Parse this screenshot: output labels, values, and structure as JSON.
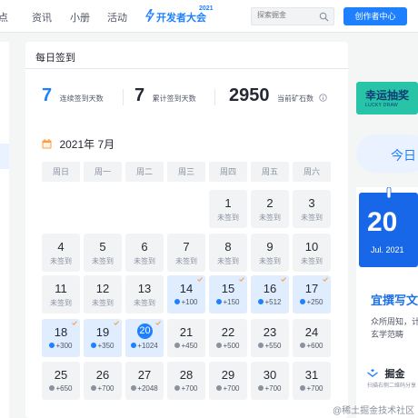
{
  "nav": {
    "items": [
      "点",
      "资讯",
      "小册",
      "活动"
    ],
    "dev_logo_text": "开发者大会",
    "dev_logo_year": "2021",
    "search_placeholder": "探索掘金",
    "creator_button": "创作者中心"
  },
  "card": {
    "title": "每日签到",
    "stats": [
      {
        "value": "7",
        "label": "连续签到天数"
      },
      {
        "value": "7",
        "label": "累计签到天数"
      },
      {
        "value": "2950",
        "label": "当前矿石数"
      }
    ],
    "month": "2021年 7月",
    "weekdays": [
      "周日",
      "周一",
      "周二",
      "周三",
      "周四",
      "周五",
      "周六"
    ],
    "days": [
      {
        "num": "1",
        "sub": "未签到"
      },
      {
        "num": "2",
        "sub": "未签到"
      },
      {
        "num": "3",
        "sub": "未签到"
      },
      {
        "num": "4",
        "sub": "未签到"
      },
      {
        "num": "5",
        "sub": "未签到"
      },
      {
        "num": "6",
        "sub": "未签到"
      },
      {
        "num": "7",
        "sub": "未签到"
      },
      {
        "num": "8",
        "sub": "未签到"
      },
      {
        "num": "9",
        "sub": "未签到"
      },
      {
        "num": "10",
        "sub": "未签到"
      },
      {
        "num": "11",
        "sub": "未签到"
      },
      {
        "num": "12",
        "sub": "未签到"
      },
      {
        "num": "13",
        "sub": "未签到"
      },
      {
        "num": "14",
        "sub": "+100"
      },
      {
        "num": "15",
        "sub": "+150"
      },
      {
        "num": "16",
        "sub": "+512"
      },
      {
        "num": "17",
        "sub": "+250"
      },
      {
        "num": "18",
        "sub": "+300"
      },
      {
        "num": "19",
        "sub": "+350"
      },
      {
        "num": "20",
        "sub": "+1024"
      },
      {
        "num": "21",
        "sub": "+450"
      },
      {
        "num": "22",
        "sub": "+500"
      },
      {
        "num": "23",
        "sub": "+550"
      },
      {
        "num": "24",
        "sub": "+600"
      },
      {
        "num": "25",
        "sub": "+650"
      },
      {
        "num": "26",
        "sub": "+700"
      },
      {
        "num": "27",
        "sub": "+2048"
      },
      {
        "num": "28",
        "sub": "+700"
      },
      {
        "num": "29",
        "sub": "+700"
      },
      {
        "num": "30",
        "sub": "+700"
      },
      {
        "num": "31",
        "sub": "+700"
      }
    ]
  },
  "right": {
    "lottery_title": "幸运抽奖",
    "lottery_sub": "LUCKY DRAW",
    "checkin_button": "今日",
    "promo_day": "20",
    "promo_date": "Jul. 2021",
    "promo_quote": "宜撰写文",
    "promo_desc1": "众所周知，计",
    "promo_desc2": "玄学范畴",
    "brand": "掘金",
    "scan_text": "扫描右侧二维码分享"
  },
  "watermark": "@稀土掘金技术社区",
  "colors": {
    "brand_blue": "#1e80ff",
    "signed_bg": "#e0edfe",
    "unsigned_bg": "#f2f3f5",
    "check_orange": "#ff9d3d"
  }
}
